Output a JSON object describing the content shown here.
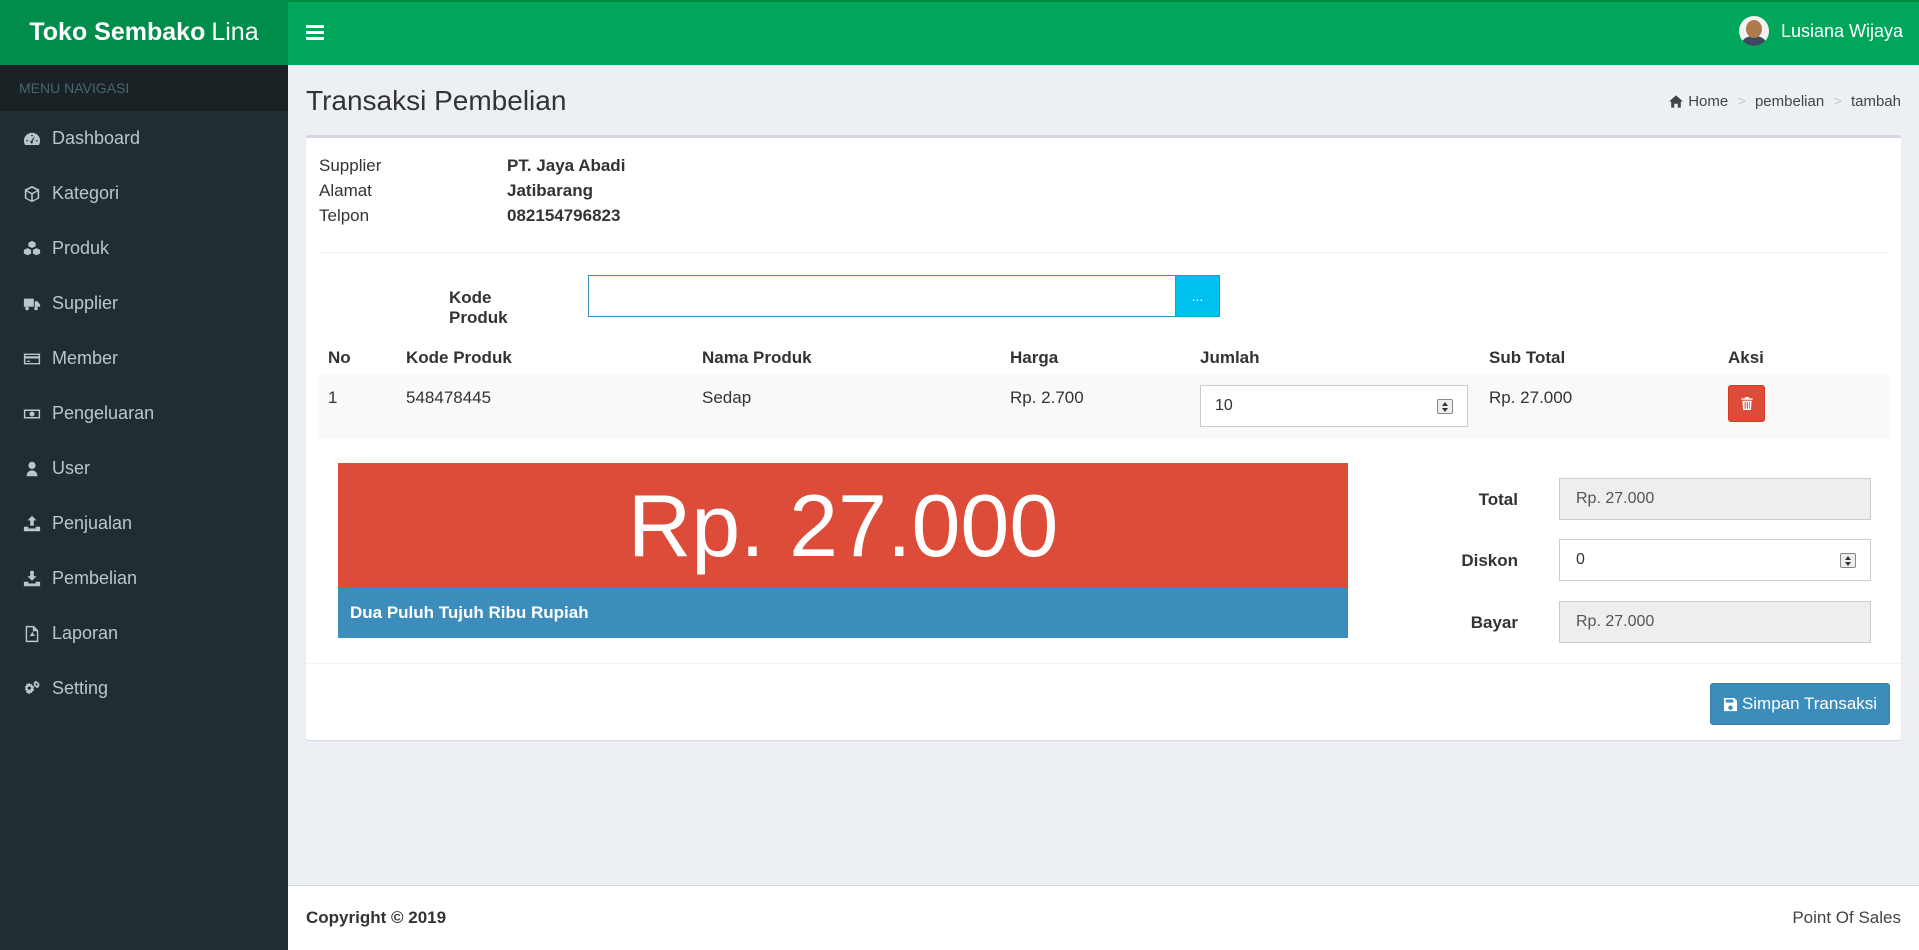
{
  "brand": {
    "bold": "Toko Sembako",
    "light": "Lina"
  },
  "user": {
    "name": "Lusiana Wijaya"
  },
  "sidebar": {
    "header": "MENU NAVIGASI",
    "items": [
      {
        "label": "Dashboard",
        "icon": "dashboard-icon"
      },
      {
        "label": "Kategori",
        "icon": "cube-icon"
      },
      {
        "label": "Produk",
        "icon": "cubes-icon"
      },
      {
        "label": "Supplier",
        "icon": "truck-icon"
      },
      {
        "label": "Member",
        "icon": "credit-card-icon"
      },
      {
        "label": "Pengeluaran",
        "icon": "money-icon"
      },
      {
        "label": "User",
        "icon": "user-icon"
      },
      {
        "label": "Penjualan",
        "icon": "upload-icon"
      },
      {
        "label": "Pembelian",
        "icon": "download-icon"
      },
      {
        "label": "Laporan",
        "icon": "file-pdf-icon"
      },
      {
        "label": "Setting",
        "icon": "gears-icon"
      }
    ]
  },
  "page": {
    "title": "Transaksi Pembelian",
    "breadcrumb": [
      "Home",
      "pembelian",
      "tambah"
    ]
  },
  "supplier": {
    "labels": {
      "supplier": "Supplier",
      "alamat": "Alamat",
      "telpon": "Telpon"
    },
    "name": "PT. Jaya Abadi",
    "alamat": "Jatibarang",
    "telpon": "082154796823"
  },
  "kode_produk": {
    "label": "Kode Produk",
    "value": "",
    "button": "..."
  },
  "table": {
    "headers": [
      "No",
      "Kode Produk",
      "Nama Produk",
      "Harga",
      "Jumlah",
      "Sub Total",
      "Aksi"
    ],
    "rows": [
      {
        "no": "1",
        "kode": "548478445",
        "nama": "Sedap",
        "harga": "Rp. 2.700",
        "jumlah": "10",
        "subtotal": "Rp. 27.000"
      }
    ]
  },
  "display": {
    "total": "Rp. 27.000",
    "terbilang": "Dua Puluh Tujuh Ribu Rupiah"
  },
  "summary": {
    "total_label": "Total",
    "total": "Rp. 27.000",
    "diskon_label": "Diskon",
    "diskon": "0",
    "bayar_label": "Bayar",
    "bayar": "Rp. 27.000"
  },
  "save_label": "Simpan Transaksi",
  "footer": {
    "copyright": "Copyright © 2019",
    "app": "Point Of Sales"
  },
  "colors": {
    "header": "#00a65a",
    "logo": "#008d4c",
    "sidebar": "#222d32",
    "total_bg": "#dd4b39",
    "terbilang_bg": "#3c8dbc",
    "info_btn": "#00c0ef"
  }
}
